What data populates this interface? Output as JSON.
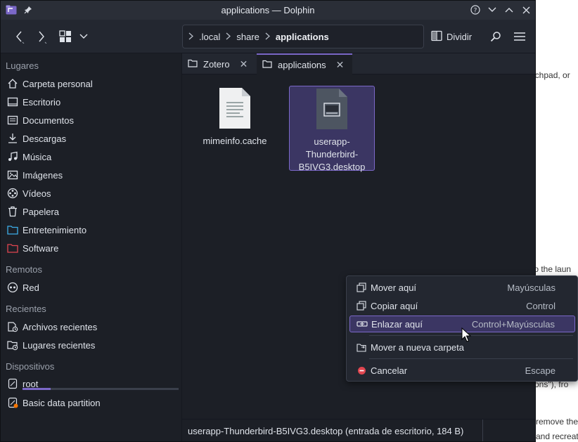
{
  "window": {
    "title": "applications — Dolphin"
  },
  "toolbar": {
    "breadcrumb": [
      ".local",
      "share",
      "applications"
    ],
    "split_label": "Dividir"
  },
  "sidebar": {
    "sections": {
      "places": "Lugares",
      "remote": "Remotos",
      "recent": "Recientes",
      "devices": "Dispositivos"
    },
    "places": [
      {
        "label": "Carpeta personal",
        "icon": "home-icon"
      },
      {
        "label": "Escritorio",
        "icon": "desktop-icon"
      },
      {
        "label": "Documentos",
        "icon": "document-icon"
      },
      {
        "label": "Descargas",
        "icon": "download-icon"
      },
      {
        "label": "Música",
        "icon": "music-icon"
      },
      {
        "label": "Imágenes",
        "icon": "image-icon"
      },
      {
        "label": "Vídeos",
        "icon": "video-icon"
      },
      {
        "label": "Papelera",
        "icon": "trash-icon"
      },
      {
        "label": "Entretenimiento",
        "icon": "folder-icon"
      },
      {
        "label": "Software",
        "icon": "folder-icon"
      }
    ],
    "remote": [
      {
        "label": "Red",
        "icon": "network-icon"
      }
    ],
    "recent": [
      {
        "label": "Archivos recientes",
        "icon": "recent-files-icon"
      },
      {
        "label": "Lugares recientes",
        "icon": "recent-places-icon"
      }
    ],
    "devices": [
      {
        "label": "root",
        "icon": "drive-icon",
        "usage": 0.18
      },
      {
        "label": "Basic data partition",
        "icon": "drive-icon"
      }
    ]
  },
  "tabs": [
    {
      "label": "Zotero",
      "active": false
    },
    {
      "label": "applications",
      "active": true
    }
  ],
  "files": [
    {
      "name": "mimeinfo.cache",
      "selected": false
    },
    {
      "name": "userapp-Thunderbird-B5IVG3.desktop",
      "selected": true
    }
  ],
  "status": {
    "text": "userapp-Thunderbird-B5IVG3.desktop (entrada de escritorio, 184 B)"
  },
  "context_menu": {
    "items": [
      {
        "label": "Mover aquí",
        "shortcut": "Mayúsculas",
        "icon": "move-icon"
      },
      {
        "label": "Copiar aquí",
        "shortcut": "Control",
        "icon": "copy-icon"
      },
      {
        "label": "Enlazar aquí",
        "shortcut": "Control+Mayúsculas",
        "icon": "link-icon",
        "highlighted": true
      },
      {
        "label": "Mover a nueva carpeta",
        "shortcut": "",
        "icon": "new-folder-icon"
      },
      {
        "label": "Cancelar",
        "shortcut": "Escape",
        "icon": "cancel-icon"
      }
    ]
  },
  "background_page": {
    "fragments": [
      "nchpad, or",
      "to the laun",
      "tions\"), fro",
      "remove the",
      "and recreat"
    ]
  },
  "colors": {
    "accent": "#7b68c8",
    "window_bg": "#1c1f26",
    "cancel_red": "#e0454f"
  }
}
